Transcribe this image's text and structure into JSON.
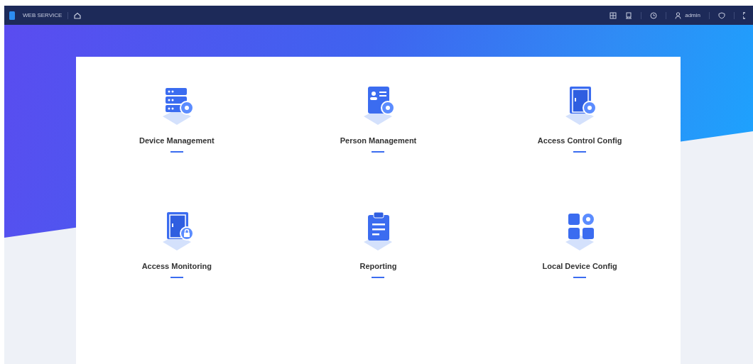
{
  "top_bar": {
    "title": "WEB SERVICE",
    "user": "admin"
  },
  "tiles": [
    {
      "label": "Device Management",
      "kind": "server"
    },
    {
      "label": "Person Management",
      "kind": "person"
    },
    {
      "label": "Access Control Config",
      "kind": "door"
    },
    {
      "label": "Access Monitoring",
      "kind": "lock"
    },
    {
      "label": "Reporting",
      "kind": "clipboard"
    },
    {
      "label": "Local Device Config",
      "kind": "blocks"
    }
  ]
}
